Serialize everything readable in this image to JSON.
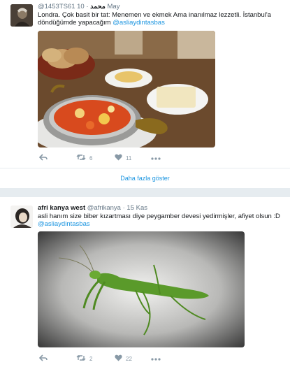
{
  "tweets": [
    {
      "handle": "@1453TS61",
      "name": "محمد",
      "time": "10 May",
      "text": "Londra. Çok basit bir tat: Menemen ve ekmek Ama inanılmaz lezzetli. İstanbul'a döndüğümde yapacağım",
      "mention": "@asliaydintasbas",
      "retweets": "6",
      "likes": "11"
    },
    {
      "name": "afri kanya west",
      "handle": "@afrikanya",
      "time": "15 Kas",
      "text": "asli hanım size biber kızartması diye peygamber devesi yedirmişler, afiyet olsun :D",
      "mention": "@asliaydintasbas",
      "retweets": "2",
      "likes": "22"
    }
  ],
  "more_link": "Daha fazla göster",
  "colors": {
    "link": "#1b95e0",
    "muted": "#8899a6",
    "divider": "#e6ecf0"
  },
  "icons": [
    "reply-icon",
    "retweet-icon",
    "like-icon",
    "more-icon"
  ]
}
